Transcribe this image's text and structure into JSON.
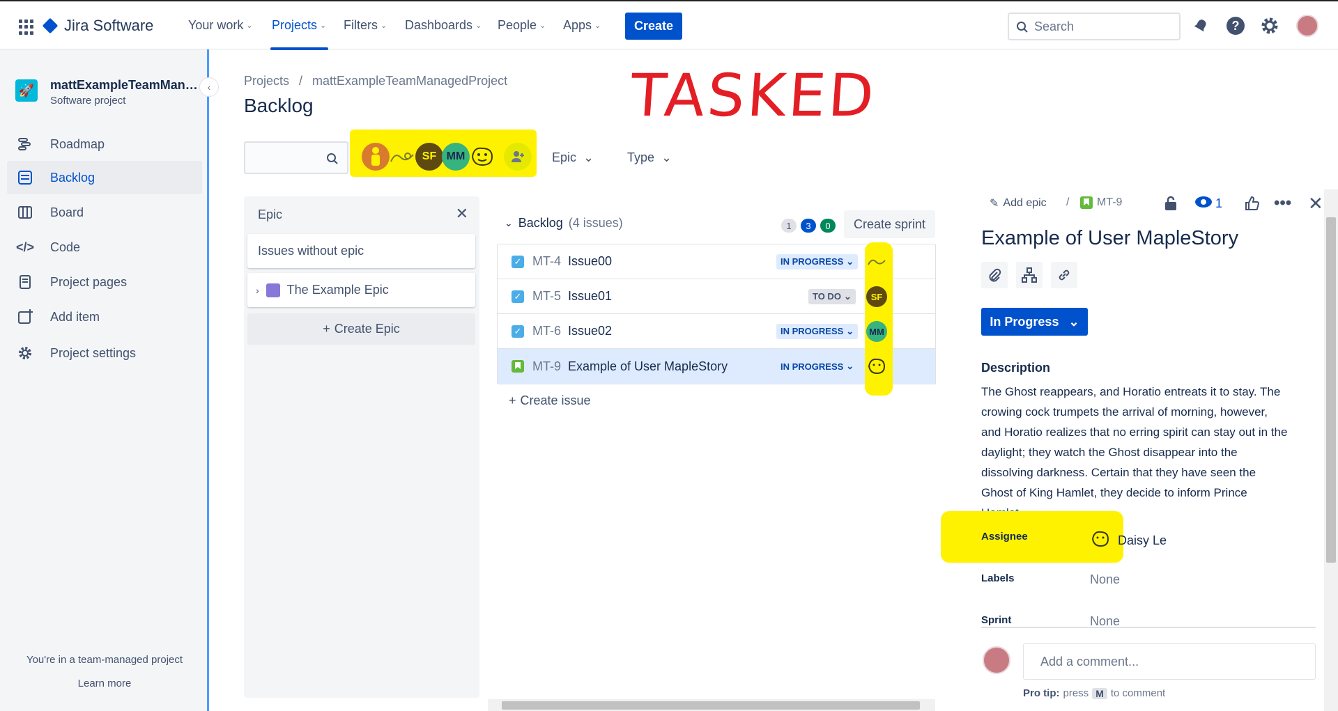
{
  "app": {
    "title": "Jira Software"
  },
  "nav": {
    "your_work": "Your work",
    "projects": "Projects",
    "filters": "Filters",
    "dashboards": "Dashboards",
    "people": "People",
    "apps": "Apps",
    "create": "Create",
    "search_placeholder": "Search"
  },
  "sidebar": {
    "project_name": "mattExampleTeamManagedProject",
    "project_type": "Software project",
    "items": [
      {
        "label": "Roadmap",
        "icon": "roadmap-icon"
      },
      {
        "label": "Backlog",
        "icon": "backlog-icon",
        "active": true
      },
      {
        "label": "Board",
        "icon": "board-icon"
      },
      {
        "label": "Code",
        "icon": "code-icon"
      },
      {
        "label": "Project pages",
        "icon": "pages-icon"
      },
      {
        "label": "Add item",
        "icon": "add-item-icon"
      },
      {
        "label": "Project settings",
        "icon": "gear-icon"
      }
    ],
    "footer": "You're in a team-managed project",
    "learn_more": "Learn more"
  },
  "breadcrumb": {
    "root": "Projects",
    "sep": "/",
    "project": "mattExampleTeamManagedProject"
  },
  "page_title": "Backlog",
  "annotation": "TASKED",
  "filters": {
    "avatars": [
      {
        "initials": "",
        "color": "#d97b2f"
      },
      {
        "initials": "",
        "color": "#fff200"
      },
      {
        "initials": "SF",
        "color": "#5e4a10"
      },
      {
        "initials": "MM",
        "color": "#36b37e"
      },
      {
        "initials": "",
        "color": "#fff200"
      }
    ],
    "epic": "Epic",
    "type": "Type"
  },
  "epic_panel": {
    "title": "Epic",
    "issues_without_epic": "Issues without epic",
    "epic_name": "The Example Epic",
    "create_epic": "Create Epic"
  },
  "backlog": {
    "title": "Backlog",
    "count": "(4 issues)",
    "counts": {
      "todo": "1",
      "in_progress": "3",
      "done": "0"
    },
    "create_sprint": "Create sprint",
    "create_issue": "Create issue",
    "issues": [
      {
        "key": "MT-4",
        "summary": "Issue00",
        "status": "IN PROGRESS",
        "type": "task",
        "assignee": ""
      },
      {
        "key": "MT-5",
        "summary": "Issue01",
        "status": "TO DO",
        "type": "task",
        "assignee": "SF"
      },
      {
        "key": "MT-6",
        "summary": "Issue02",
        "status": "IN PROGRESS",
        "type": "task",
        "assignee": "MM"
      },
      {
        "key": "MT-9",
        "summary": "Example of User MapleStory",
        "status": "IN PROGRESS",
        "type": "story",
        "assignee": ""
      }
    ]
  },
  "detail": {
    "add_epic": "Add epic",
    "sep": "/",
    "key": "MT-9",
    "watchers": "1",
    "title": "Example of User MapleStory",
    "status": "In Progress",
    "description_label": "Description",
    "description": "The Ghost reappears, and Horatio entreats it to stay. The crowing cock trumpets the arrival of morning, however, and Horatio realizes that no erring spirit can stay out in the daylight; they watch the Ghost disappear into the dissolving darkness. Certain that they have seen the Ghost of King Hamlet, they decide to inform Prince ",
    "description_link": "Hamlet",
    "description_end": ".",
    "assignee_label": "Assignee",
    "assignee": "Daisy Le",
    "labels_label": "Labels",
    "labels": "None",
    "sprint_label": "Sprint",
    "sprint": "None",
    "comment_placeholder": "Add a comment...",
    "pro_tip": "Pro tip:",
    "press": "press",
    "key_hint": "M",
    "to_comment": "to comment"
  }
}
